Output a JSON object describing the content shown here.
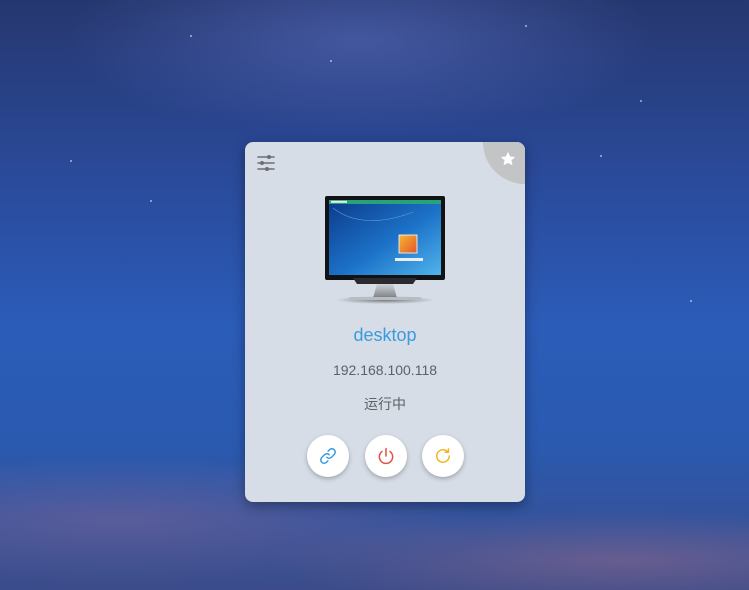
{
  "desktop_card": {
    "name": "desktop",
    "ip": "192.168.100.118",
    "status": "运行中"
  },
  "icons": {
    "settings": "sliders-icon",
    "favorite": "star-icon",
    "connect": "link-icon",
    "power": "power-icon",
    "restart": "refresh-icon",
    "monitor": "monitor-icon"
  },
  "colors": {
    "name_text": "#3a9be0",
    "connect_icon": "#3a9be0",
    "power_icon": "#e0524a",
    "restart_icon": "#f2b51c",
    "card_bg": "#d6dde6"
  }
}
